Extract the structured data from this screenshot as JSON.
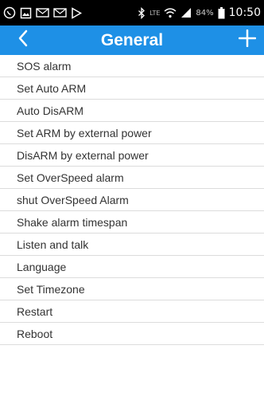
{
  "status_bar": {
    "left_icons": [
      "whatsapp-icon",
      "image-icon",
      "email-icon",
      "email-icon",
      "play-store-icon"
    ],
    "right_icons": [
      "bluetooth-icon",
      "lte-icon",
      "wifi-icon",
      "signal-icon"
    ],
    "lte_text": "LTE",
    "battery_percent": "84%",
    "time": "10:50"
  },
  "header": {
    "title": "General",
    "back_icon": "chevron-left-icon",
    "add_icon": "plus-icon",
    "background_color": "#1e90e6"
  },
  "menu": {
    "items": [
      {
        "label": "SOS alarm"
      },
      {
        "label": "Set Auto ARM"
      },
      {
        "label": "Auto DisARM"
      },
      {
        "label": "Set ARM by external power"
      },
      {
        "label": "DisARM by external power"
      },
      {
        "label": "Set OverSpeed alarm"
      },
      {
        "label": "shut OverSpeed Alarm"
      },
      {
        "label": "Shake alarm timespan"
      },
      {
        "label": "Listen and talk"
      },
      {
        "label": "Language"
      },
      {
        "label": "Set Timezone"
      },
      {
        "label": "Restart"
      },
      {
        "label": "Reboot"
      }
    ]
  }
}
